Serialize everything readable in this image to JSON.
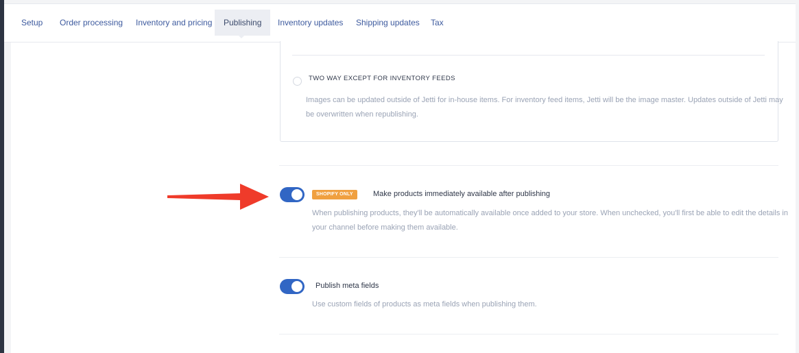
{
  "tabs": {
    "setup": "Setup",
    "order_processing": "Order processing",
    "inventory_pricing": "Inventory and pricing",
    "publishing": "Publishing",
    "inventory_updates": "Inventory updates",
    "shipping_updates": "Shipping updates",
    "tax": "Tax",
    "active": "Publishing"
  },
  "image_sync": {
    "option_title": "TWO WAY EXCEPT FOR INVENTORY FEEDS",
    "option_desc_line1": "Images can be updated outside of Jetti for in-house items. For inventory feed items, Jetti will be the image master. Updates outside of Jetti may",
    "option_desc_line2": "be overwritten when republishing.",
    "selected": false
  },
  "settings": {
    "immediate_availability": {
      "badge": "SHOPIFY ONLY",
      "label": "Make products immediately available after publishing",
      "desc_line1": "When publishing products, they'll be automatically available once added to your store. When unchecked, you'll first be able to edit the details in",
      "desc_line2": "your channel before making them available.",
      "enabled": true
    },
    "meta_fields": {
      "label": "Publish meta fields",
      "desc": "Use custom fields of products as meta fields when publishing them.",
      "enabled": true
    }
  },
  "colors": {
    "toggle_on": "#3166c4",
    "badge": "#f0a040",
    "arrow": "#ef3b2a",
    "link": "#3d5a9e"
  }
}
